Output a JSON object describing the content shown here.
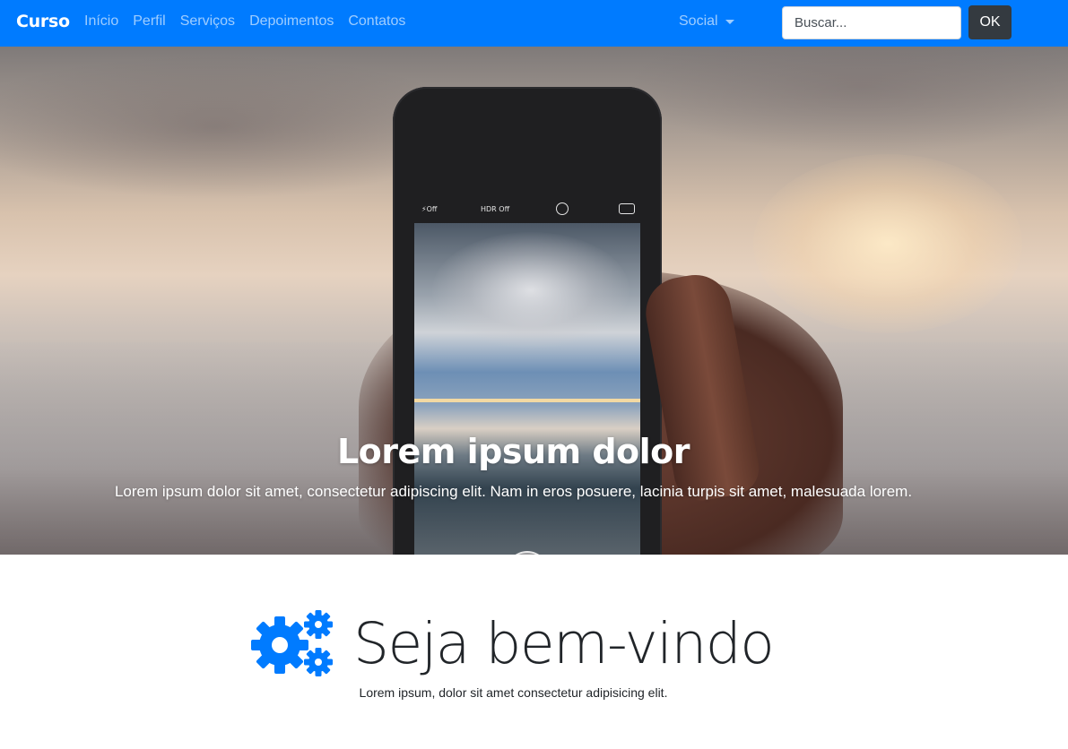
{
  "navbar": {
    "brand": "Curso",
    "links": [
      "Início",
      "Perfil",
      "Serviços",
      "Depoimentos",
      "Contatos"
    ],
    "social_label": "Social",
    "search_placeholder": "Buscar...",
    "ok_label": "OK"
  },
  "hero": {
    "phone_flash": "Off",
    "phone_hdr": "HDR Off",
    "title": "Lorem ipsum dolor",
    "text": "Lorem ipsum dolor sit amet, consectetur adipiscing elit. Nam in eros posuere, lacinia turpis sit amet, malesuada lorem."
  },
  "welcome": {
    "title": "Seja bem-vindo",
    "subtitle": "Lorem ipsum, dolor sit amet consectetur adipisicing elit.",
    "icon": "cogs-icon"
  },
  "colors": {
    "primary": "#007bff",
    "dark_button": "#343a40"
  }
}
